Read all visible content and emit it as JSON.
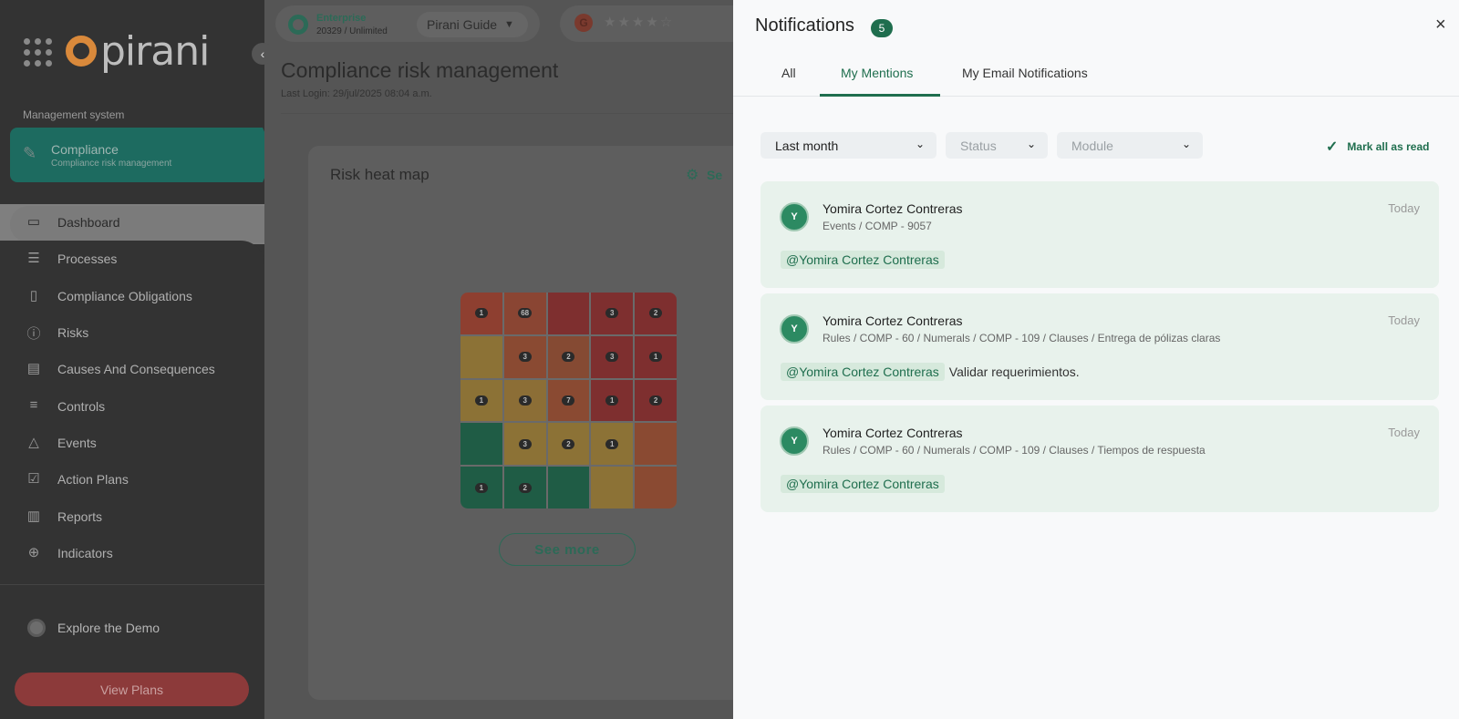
{
  "sidebar": {
    "brand": "pirani",
    "section_label": "Management system",
    "module": {
      "title": "Compliance",
      "subtitle": "Compliance risk management"
    },
    "items": [
      {
        "label": "Dashboard",
        "icon": "monitor-icon",
        "glyph": "▭"
      },
      {
        "label": "Processes",
        "icon": "list-icon",
        "glyph": "☰"
      },
      {
        "label": "Compliance Obligations",
        "icon": "document-icon",
        "glyph": "▯"
      },
      {
        "label": "Risks",
        "icon": "alert-circle-icon",
        "glyph": "ⓘ"
      },
      {
        "label": "Causes And Consequences",
        "icon": "card-icon",
        "glyph": "▤"
      },
      {
        "label": "Controls",
        "icon": "sliders-icon",
        "glyph": "≡"
      },
      {
        "label": "Events",
        "icon": "warning-icon",
        "glyph": "△"
      },
      {
        "label": "Action Plans",
        "icon": "checklist-icon",
        "glyph": "☑"
      },
      {
        "label": "Reports",
        "icon": "bar-chart-icon",
        "glyph": "▥"
      },
      {
        "label": "Indicators",
        "icon": "target-icon",
        "glyph": "⊕"
      }
    ],
    "explore_label": "Explore the Demo",
    "view_plans_label": "View Plans"
  },
  "topbar": {
    "plan_name": "Enterprise",
    "plan_sub": "20329 / Unlimited",
    "guide_label": "Pirani Guide",
    "rating_logo": "G",
    "stars": "★★★★☆"
  },
  "main": {
    "title": "Compliance risk management",
    "last_login": "Last Login: 29/jul/2025 08:04 a.m.",
    "card": {
      "title": "Risk heat map",
      "settings_label": "Se",
      "see_more_label": "See more",
      "heatmap": [
        [
          {
            "color": "#8e3f30",
            "count": "1"
          },
          {
            "color": "#8a4533",
            "count": "68"
          },
          {
            "color": "#7e2f2f",
            "count": ""
          },
          {
            "color": "#7e2f2f",
            "count": "3"
          },
          {
            "color": "#7e2f2f",
            "count": "2"
          }
        ],
        [
          {
            "color": "#8c7236",
            "count": ""
          },
          {
            "color": "#8a4a32",
            "count": "3"
          },
          {
            "color": "#854a33",
            "count": "2"
          },
          {
            "color": "#7e2f2f",
            "count": "3"
          },
          {
            "color": "#7e2f2f",
            "count": "1"
          }
        ],
        [
          {
            "color": "#8c7236",
            "count": "1"
          },
          {
            "color": "#8c6e36",
            "count": "3"
          },
          {
            "color": "#8a4a32",
            "count": "7"
          },
          {
            "color": "#7e2f2f",
            "count": "1"
          },
          {
            "color": "#7e2f2f",
            "count": "2"
          }
        ],
        [
          {
            "color": "#1f5c45",
            "count": ""
          },
          {
            "color": "#8c7236",
            "count": "3"
          },
          {
            "color": "#8c7236",
            "count": "2"
          },
          {
            "color": "#8c7236",
            "count": "1"
          },
          {
            "color": "#8a4a32",
            "count": ""
          }
        ],
        [
          {
            "color": "#1f5c45",
            "count": "1"
          },
          {
            "color": "#1f5c45",
            "count": "2"
          },
          {
            "color": "#1f5c45",
            "count": ""
          },
          {
            "color": "#8c7236",
            "count": ""
          },
          {
            "color": "#8a4a32",
            "count": ""
          }
        ]
      ]
    }
  },
  "notifications": {
    "title": "Notifications",
    "count": "5",
    "close_icon": "×",
    "tabs": [
      "All",
      "My Mentions",
      "My Email Notifications"
    ],
    "active_tab": 1,
    "filters": {
      "period": "Last month",
      "status_placeholder": "Status",
      "module_placeholder": "Module"
    },
    "mark_all_label": "Mark all as read",
    "items": [
      {
        "initial": "Y",
        "name": "Yomira Cortez Contreras",
        "path": "Events / COMP - 9057",
        "date": "Today",
        "mention": "@Yomira Cortez Contreras",
        "message": ""
      },
      {
        "initial": "Y",
        "name": "Yomira Cortez Contreras",
        "path": "Rules / COMP - 60 / Numerals / COMP - 109 / Clauses / Entrega de pólizas claras",
        "date": "Today",
        "mention": "@Yomira Cortez Contreras",
        "message": "Validar requerimientos."
      },
      {
        "initial": "Y",
        "name": "Yomira Cortez Contreras",
        "path": "Rules / COMP - 60 / Numerals / COMP - 109 / Clauses / Tiempos de respuesta",
        "date": "Today",
        "mention": "@Yomira Cortez Contreras",
        "message": ""
      }
    ]
  },
  "colors": {
    "accent": "#1f6e4e",
    "brand_orange": "#d9893b",
    "view_plans": "#c0504d"
  }
}
